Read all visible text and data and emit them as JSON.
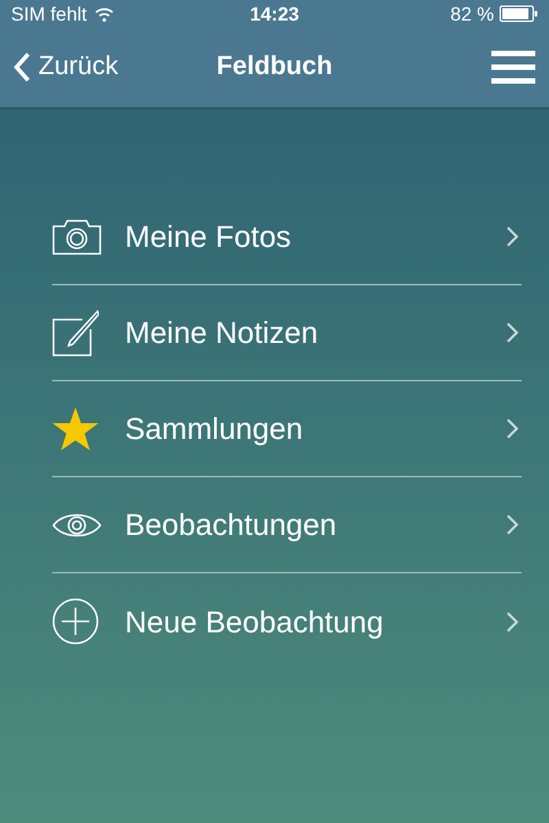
{
  "status_bar": {
    "carrier": "SIM fehlt",
    "time": "14:23",
    "battery": "82 %"
  },
  "nav_bar": {
    "back": "Zurück",
    "title": "Feldbuch"
  },
  "menu": [
    {
      "kind": "camera",
      "label": "Meine Fotos"
    },
    {
      "kind": "note",
      "label": "Meine Notizen"
    },
    {
      "kind": "star",
      "label": "Sammlungen"
    },
    {
      "kind": "eye",
      "label": "Beobachtungen"
    },
    {
      "kind": "plus",
      "label": "Neue Beobachtung"
    }
  ]
}
